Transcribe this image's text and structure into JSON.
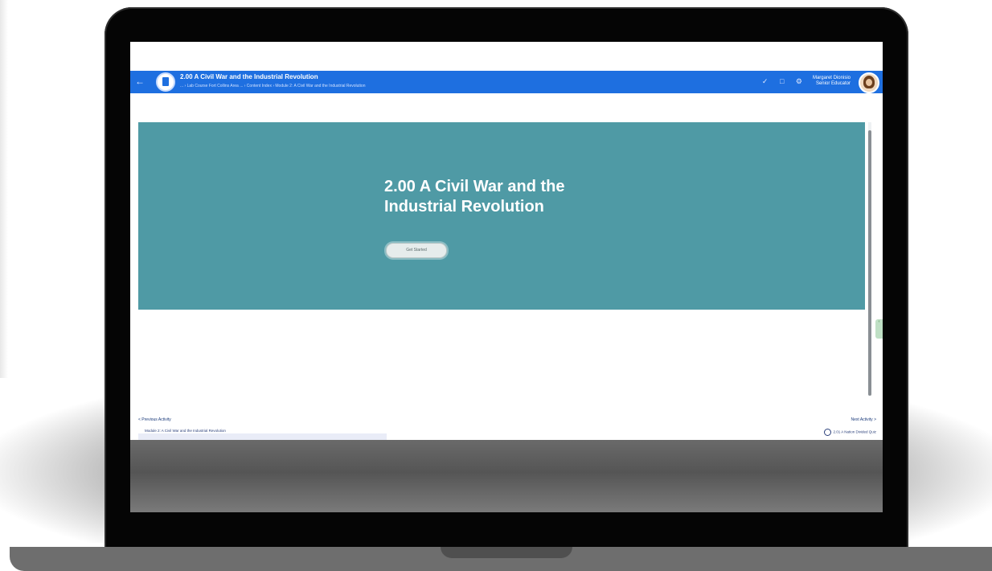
{
  "header": {
    "back_icon": "arrow-left-icon",
    "title": "2.00 A Civil War and the Industrial Revolution",
    "breadcrumb": "...  ›  Lab Course Fort Collins Area ... › Content Index › Module 2: A Civil War and the Industrial Revolution",
    "icons": [
      "check-icon",
      "chat-icon",
      "settings-icon"
    ],
    "user_name": "Margaret Dionisio",
    "user_role": "Senior Educator"
  },
  "hero": {
    "title": "2.00 A Civil War and the Industrial Revolution",
    "button_label": "Get Started",
    "color": "#4f9aa5"
  },
  "footer": {
    "prev_label": "< Previous Activity",
    "prev_sub": "Module 2: A Civil War and the Industrial Revolution",
    "next_label": "Next Activity >",
    "next_sub": "2.01 A Nation Divided Quiz"
  },
  "colors": {
    "header": "#1e6fe0",
    "hero": "#4f9aa5",
    "laptop_bezel": "#050505",
    "laptop_base": "#6e6e6e"
  }
}
